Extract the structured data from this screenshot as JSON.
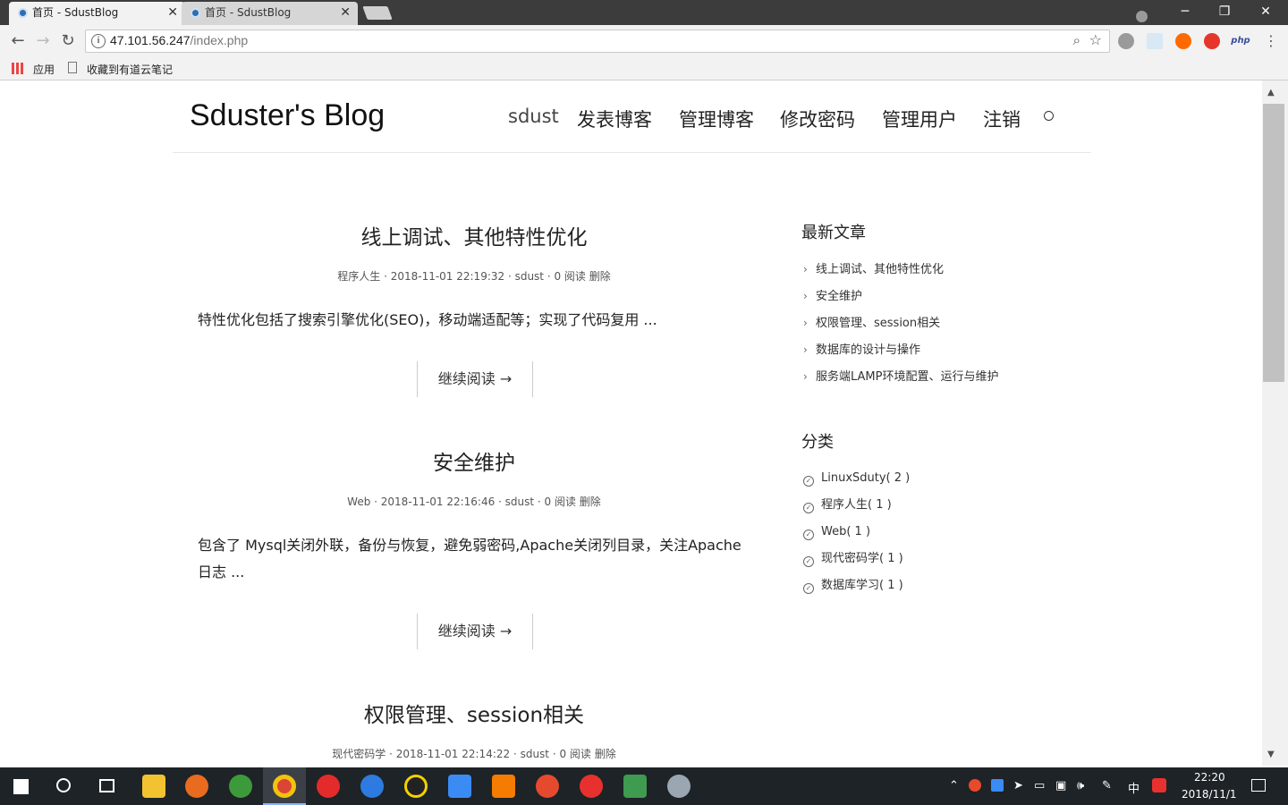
{
  "browser": {
    "tabs": [
      {
        "label": "首页 - SdustBlog",
        "close": "✕"
      },
      {
        "label": "首页 - SdustBlog",
        "close": "✕"
      }
    ],
    "window_controls": {
      "minimize": "─",
      "maximize": "❐",
      "close": "✕"
    },
    "url_host": "47.101.56.247",
    "url_path": "/index.php",
    "bookmarks": {
      "apps_label": "应用",
      "item1": "收藏到有道云笔记"
    },
    "extensions": [
      "php"
    ]
  },
  "site": {
    "title": "Sduster's Blog",
    "nav": [
      "sdust",
      "发表博客",
      "管理博客",
      "修改密码",
      "管理用户",
      "注销"
    ]
  },
  "posts": [
    {
      "title": "线上调试、其他特性优化",
      "meta": "程序人生 · 2018-11-01 22:19:32 · sdust · 0 阅读 删除",
      "excerpt": "特性优化包括了搜索引擎优化(SEO)，移动端适配等；实现了代码复用   ...",
      "readmore": "继续阅读 →"
    },
    {
      "title": "安全维护",
      "meta": "Web · 2018-11-01 22:16:46 · sdust · 0 阅读 删除",
      "excerpt_line1": "包含了 Mysql关闭外联，备份与恢复，避免弱密码,Apache关闭列目录，关注Apache",
      "excerpt_line2": "日志   ...",
      "readmore": "继续阅读 →"
    },
    {
      "title": "权限管理、session相关",
      "meta": "现代密码学 · 2018-11-01 22:14:22 · sdust · 0 阅读 删除"
    }
  ],
  "sidebar": {
    "latest_heading": "最新文章",
    "latest": [
      "线上调试、其他特性优化",
      "安全维护",
      "权限管理、session相关",
      "数据库的设计与操作",
      "服务端LAMP环境配置、运行与维护"
    ],
    "category_heading": "分类",
    "categories": [
      "LinuxSduty( 2 )",
      "程序人生( 1 )",
      "Web( 1 )",
      "现代密码学( 1 )",
      "数据库学习( 1 )"
    ]
  },
  "taskbar": {
    "ime": "中",
    "time": "22:20",
    "date": "2018/11/1"
  }
}
